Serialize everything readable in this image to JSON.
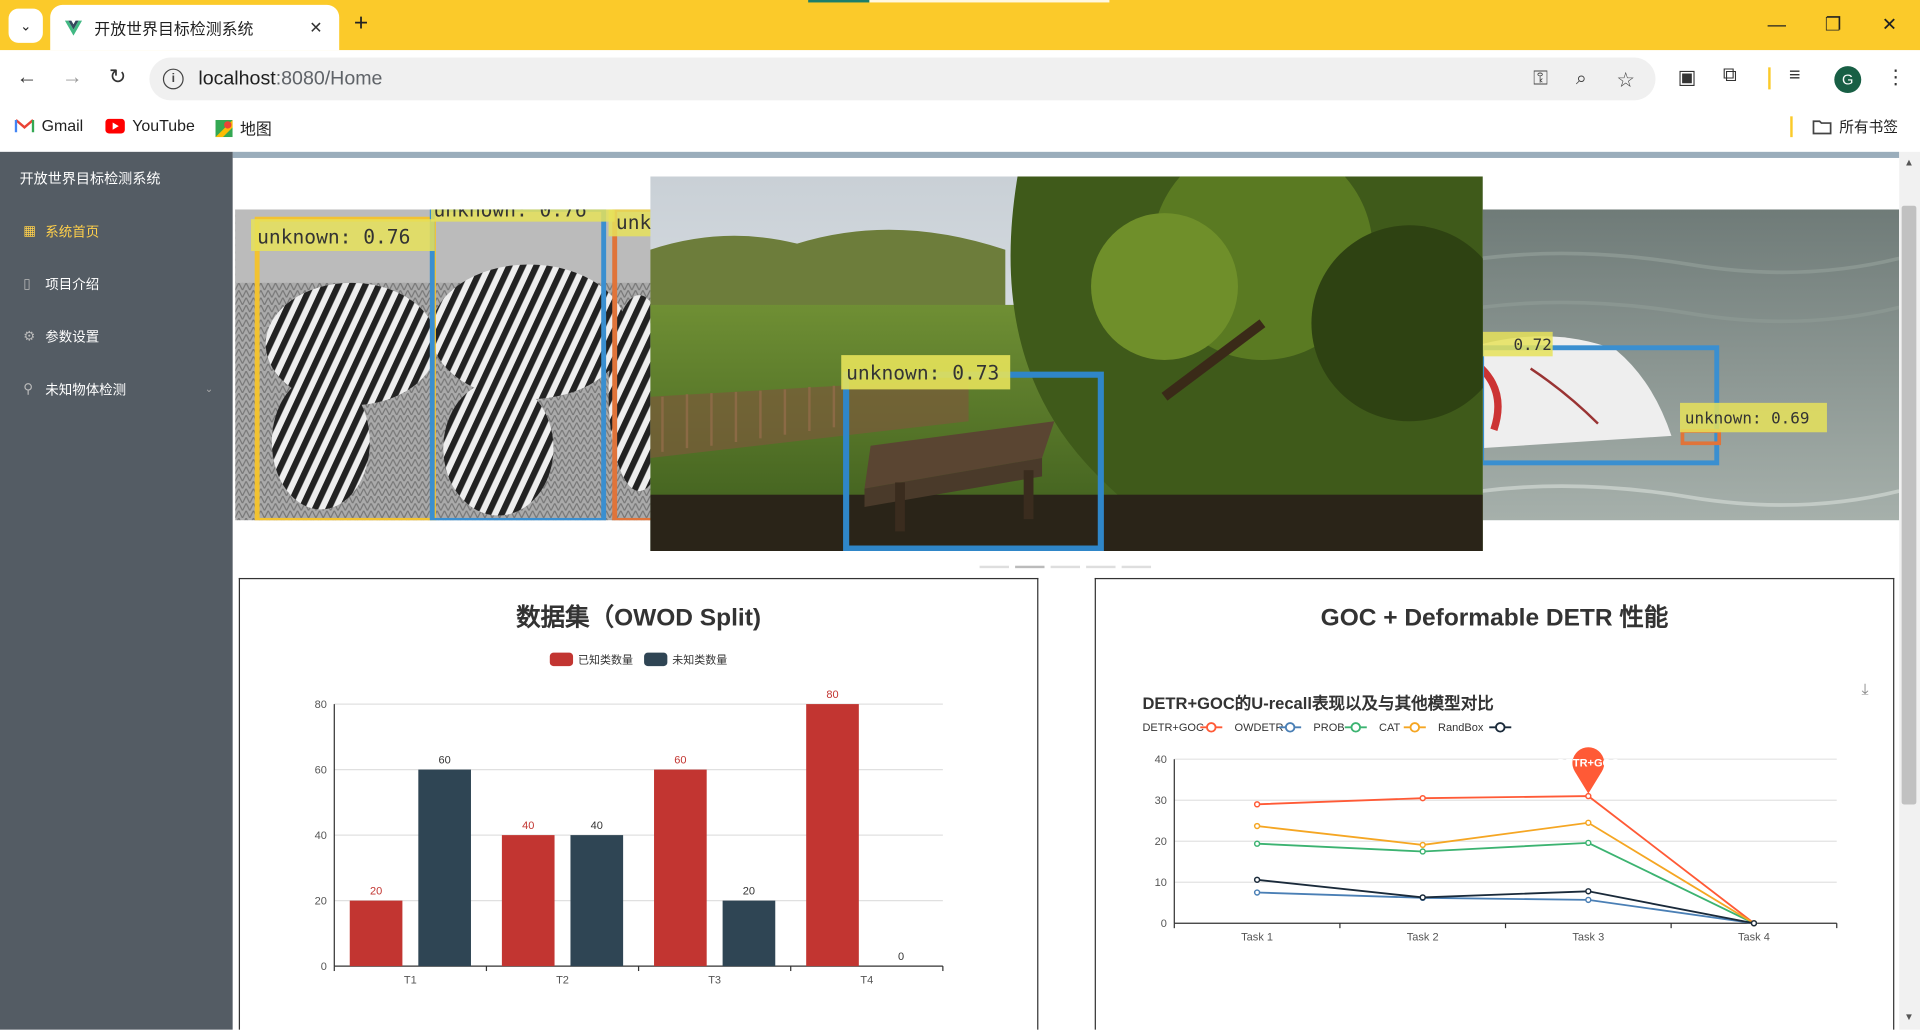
{
  "browser": {
    "tab_title": "开放世界目标检测系统",
    "tab_close": "✕",
    "new_tab": "+",
    "url_host": "localhost",
    "url_path": ":8080/Home",
    "avatar_letter": "G",
    "accent_color": "#fbca2a"
  },
  "bookmarks": [
    {
      "label": "Gmail",
      "icon": "gmail-icon"
    },
    {
      "label": "YouTube",
      "icon": "youtube-icon"
    },
    {
      "label": "地图",
      "icon": "maps-icon"
    },
    {
      "label": "所有书签",
      "icon": "folder-icon"
    }
  ],
  "sidebar": {
    "title": "开放世界目标检测系统",
    "items": [
      {
        "label": "系统首页",
        "icon": "grid-icon",
        "active": true
      },
      {
        "label": "项目介绍",
        "icon": "document-icon",
        "active": false
      },
      {
        "label": "参数设置",
        "icon": "gear-icon",
        "active": false
      },
      {
        "label": "未知物体检测",
        "icon": "location-icon",
        "active": false,
        "expandable": true
      }
    ]
  },
  "carousel": {
    "left": {
      "labels": [
        "unknown:  0.76",
        "unknown:  0.76",
        "unk"
      ]
    },
    "center": {
      "labels": [
        "unknown:  0.73"
      ]
    },
    "right": {
      "labels": [
        "0.72",
        "unknown:  0.69"
      ]
    }
  },
  "panels": {
    "left_title": "数据集（OWOD Split)",
    "right_title": "GOC + Deformable DETR 性能"
  },
  "chart_data": [
    {
      "type": "bar",
      "title": "数据集（OWOD Split)",
      "categories": [
        "T1",
        "T2",
        "T3",
        "T4"
      ],
      "series": [
        {
          "name": "已知类数量",
          "values": [
            20,
            40,
            60,
            80
          ],
          "color": "#c23531"
        },
        {
          "name": "未知类数量",
          "values": [
            60,
            40,
            20,
            0
          ],
          "color": "#2f4554"
        }
      ],
      "ylim": [
        0,
        80
      ],
      "yticks": [
        0,
        20,
        40,
        60,
        80
      ],
      "legend": "top-center",
      "grid": true
    },
    {
      "type": "line",
      "title": "DETR+GOC的U-recall表现以及与其他模型对比",
      "categories": [
        "Task 1",
        "Task 2",
        "Task 3",
        "Task 4"
      ],
      "series": [
        {
          "name": "DETR+GOC",
          "values": [
            29,
            30.5,
            31,
            0
          ],
          "color": "#ff5a36"
        },
        {
          "name": "OWDETR",
          "values": [
            7.5,
            6.2,
            5.7,
            0
          ],
          "color": "#4a7fb5"
        },
        {
          "name": "PROB",
          "values": [
            19.4,
            17.5,
            19.6,
            0
          ],
          "color": "#3cb371"
        },
        {
          "name": "CAT",
          "values": [
            23.7,
            19.1,
            24.5,
            0
          ],
          "color": "#f5a623"
        },
        {
          "name": "RandBox",
          "values": [
            10.6,
            6.3,
            7.8,
            0
          ],
          "color": "#1a2a3a"
        }
      ],
      "ylim": [
        0,
        40
      ],
      "yticks": [
        0,
        10,
        20,
        30,
        40
      ],
      "markpoint": {
        "series": "DETR+GOC",
        "label": "DETR+GOC",
        "category": "Task 3"
      },
      "legend": "top-left",
      "grid": true
    }
  ]
}
